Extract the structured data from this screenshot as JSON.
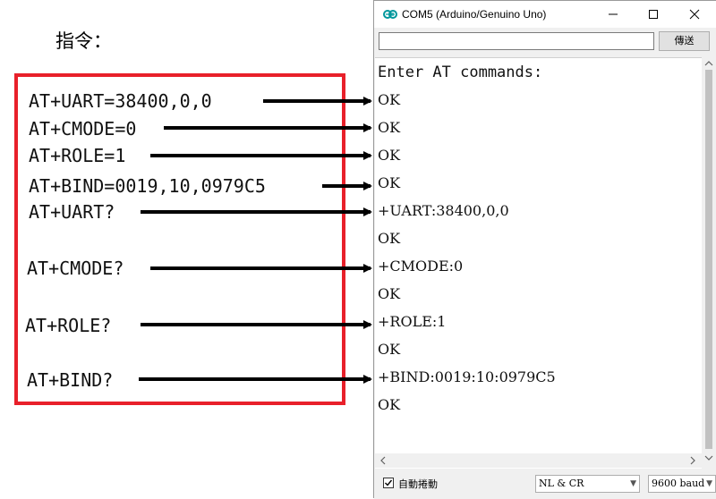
{
  "annotation": {
    "heading": "指令：",
    "commands": [
      "AT+UART=38400,0,0",
      "AT+CMODE=0",
      "AT+ROLE=1",
      "AT+BIND=0019,10,0979C5",
      "AT+UART?",
      "AT+CMODE?",
      "AT+ROLE?",
      "AT+BIND?"
    ],
    "box_color": "#e8202a"
  },
  "window": {
    "title": "COM5 (Arduino/Genuino Uno)",
    "icon": "arduino-logo-icon"
  },
  "send_row": {
    "input_value": "",
    "send_label": "傳送"
  },
  "output_lines": [
    "Enter AT commands:",
    "OK",
    "OK",
    "OK",
    "OK",
    "+UART:38400,0,0",
    "OK",
    "+CMODE:0",
    "OK",
    "+ROLE:1",
    "OK",
    "+BIND:0019:10:0979C5",
    "OK"
  ],
  "statusbar": {
    "autoscroll_label": "自動捲動",
    "autoscroll_checked": true,
    "line_ending": "NL & CR",
    "baud_rate": "9600 baud"
  }
}
